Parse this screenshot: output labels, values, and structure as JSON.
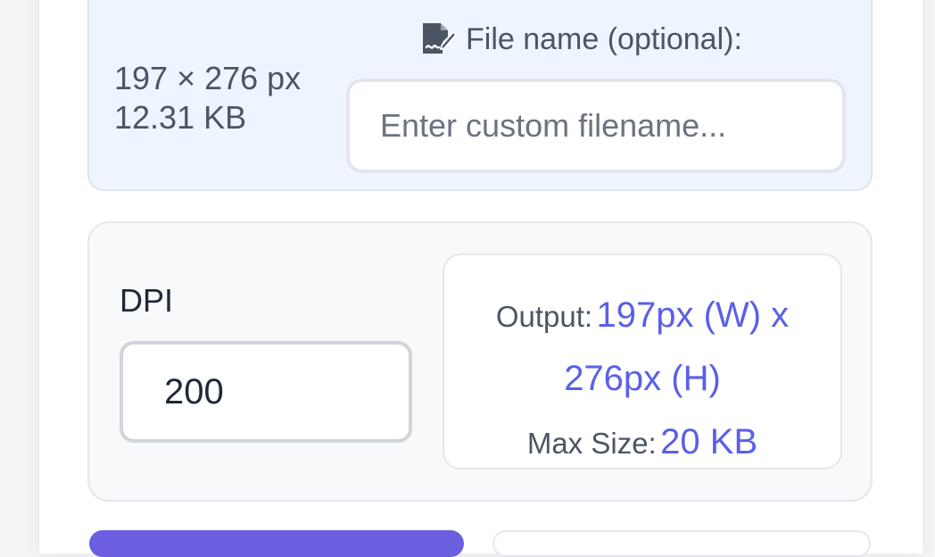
{
  "image_info": {
    "dimensions": "197 × 276 px",
    "file_size": "12.31 KB"
  },
  "filename": {
    "icon": "file-signature-icon",
    "label": "File name (optional):",
    "placeholder": "Enter custom filename...",
    "value": ""
  },
  "dpi": {
    "label": "DPI",
    "value": "200"
  },
  "output": {
    "output_label": "Output:",
    "dimensions_line1": "197px (W) x",
    "dimensions_line2": "276px (H)",
    "max_size_label": "Max Size:",
    "max_size_value": "20 KB"
  },
  "colors": {
    "accent": "#5b5fe8",
    "primary_button": "#6b5fe0",
    "info_panel_bg": "#eef5ff"
  }
}
